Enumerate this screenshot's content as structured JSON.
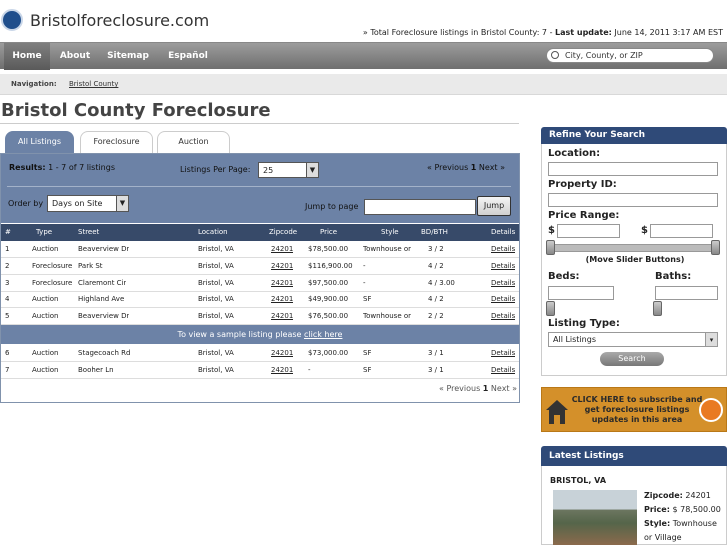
{
  "site": {
    "logo_text": "Bristolforeclosure.com"
  },
  "topline": {
    "text": "» Total Foreclosure listings in Bristol County: 7 - ",
    "update_label": "Last update:",
    "update_value": " June 14, 2011 3:17 AM EST"
  },
  "nav": {
    "home": "Home",
    "about": "About",
    "sitemap": "Sitemap",
    "espanol": "Español",
    "search_placeholder": "City, County, or ZIP"
  },
  "breadcrumb": {
    "label": "Navigation:",
    "link": "Bristol County"
  },
  "page": {
    "title": "Bristol County Foreclosure"
  },
  "tabs": [
    "All Listings",
    "Foreclosure",
    "Auction"
  ],
  "results": {
    "label": "Results:",
    "value": " 1 - 7 of 7 listings",
    "per_page_label": "Listings Per Page:",
    "per_page_value": "25",
    "prev": "« Previous",
    "page": "1",
    "next": "Next »"
  },
  "order": {
    "label": "Order by",
    "value": "Days on Site",
    "jump_label": "Jump to page",
    "jump_button": "Jump"
  },
  "table": {
    "headers": [
      "#",
      "Type",
      "Street",
      "Location",
      "Zipcode",
      "Price",
      "Style",
      "BD/BTH",
      "Details"
    ],
    "rows": [
      [
        "1",
        "Auction",
        "Beaverview Dr",
        "Bristol, VA",
        "24201",
        "$78,500.00",
        "Townhouse or",
        "3 / 2",
        "Details"
      ],
      [
        "2",
        "Foreclosure",
        "Park St",
        "Bristol, VA",
        "24201",
        "$116,900.00",
        "-",
        "4 / 2",
        "Details"
      ],
      [
        "3",
        "Foreclosure",
        "Claremont Cir",
        "Bristol, VA",
        "24201",
        "$97,500.00",
        "-",
        "4 / 3.00",
        "Details"
      ],
      [
        "4",
        "Auction",
        "Highland Ave",
        "Bristol, VA",
        "24201",
        "$49,900.00",
        "SF",
        "4 / 2",
        "Details"
      ],
      [
        "5",
        "Auction",
        "Beaverview Dr",
        "Bristol, VA",
        "24201",
        "$76,500.00",
        "Townhouse or",
        "2 / 2",
        "Details"
      ],
      [
        "6",
        "Auction",
        "Stagecoach Rd",
        "Bristol, VA",
        "24201",
        "$73,000.00",
        "SF",
        "3 / 1",
        "Details"
      ],
      [
        "7",
        "Auction",
        "Booher Ln",
        "Bristol, VA",
        "24201",
        "-",
        "SF",
        "3 / 1",
        "Details"
      ]
    ],
    "sample_text": "To view a sample listing please ",
    "sample_link": "click here"
  },
  "refine": {
    "title": "Refine Your Search",
    "location": "Location:",
    "property_id": "Property ID:",
    "price_range": "Price Range:",
    "dollar": "$",
    "slider_note": "(Move Slider Buttons)",
    "beds": "Beds:",
    "baths": "Baths:",
    "listing_type": "Listing Type:",
    "listing_type_value": "All Listings",
    "search_button": "Search"
  },
  "subscribe": {
    "text": "CLICK HERE to subscribe and get foreclosure listings updates in this area"
  },
  "latest": {
    "title": "Latest Listings",
    "city": "BRISTOL, VA",
    "zip_label": "Zipcode:",
    "zip_value": " 24201",
    "price_label": "Price:",
    "price_value": " $ 78,500.00",
    "style_label": "Style:",
    "style_value": " Townhouse",
    "style_cont": "or Village"
  }
}
